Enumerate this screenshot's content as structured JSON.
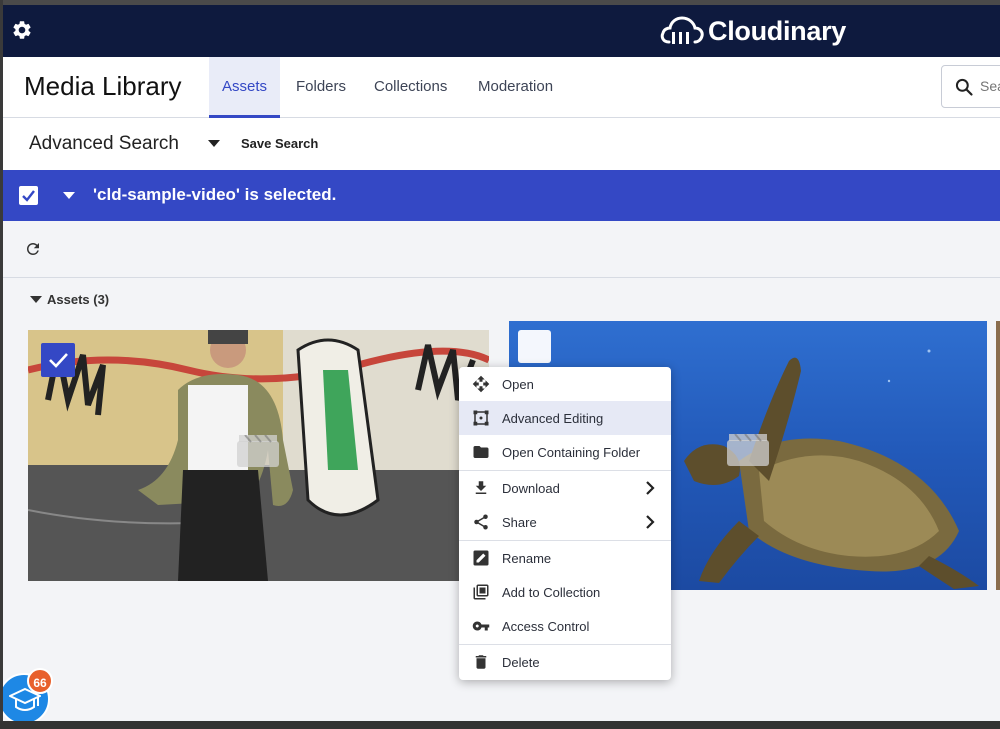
{
  "brand": {
    "name": "Cloudinary"
  },
  "header": {
    "title": "Media Library",
    "tabs": [
      {
        "label": "Assets",
        "active": true
      },
      {
        "label": "Folders"
      },
      {
        "label": "Collections"
      },
      {
        "label": "Moderation"
      }
    ],
    "search_placeholder": "Search"
  },
  "advanced_search": {
    "title": "Advanced Search",
    "save_label": "Save Search"
  },
  "selection": {
    "text": "'cld-sample-video' is selected."
  },
  "assets": {
    "label": "Assets (3)"
  },
  "context_menu": {
    "items": [
      {
        "label": "Open",
        "icon": "move-icon"
      },
      {
        "label": "Advanced Editing",
        "icon": "crop-icon",
        "highlighted": true
      },
      {
        "label": "Open Containing Folder",
        "icon": "folder-icon"
      },
      {
        "label": "Download",
        "icon": "download-icon",
        "submenu": true
      },
      {
        "label": "Share",
        "icon": "share-icon",
        "submenu": true
      },
      {
        "label": "Rename",
        "icon": "rename-icon"
      },
      {
        "label": "Add to Collection",
        "icon": "collection-icon"
      },
      {
        "label": "Access Control",
        "icon": "key-icon"
      },
      {
        "label": "Delete",
        "icon": "trash-icon"
      }
    ]
  },
  "academy": {
    "count": "66"
  },
  "colors": {
    "accent": "#3448c5",
    "topbar": "#0e1a3e",
    "badge": "#e8602c"
  }
}
